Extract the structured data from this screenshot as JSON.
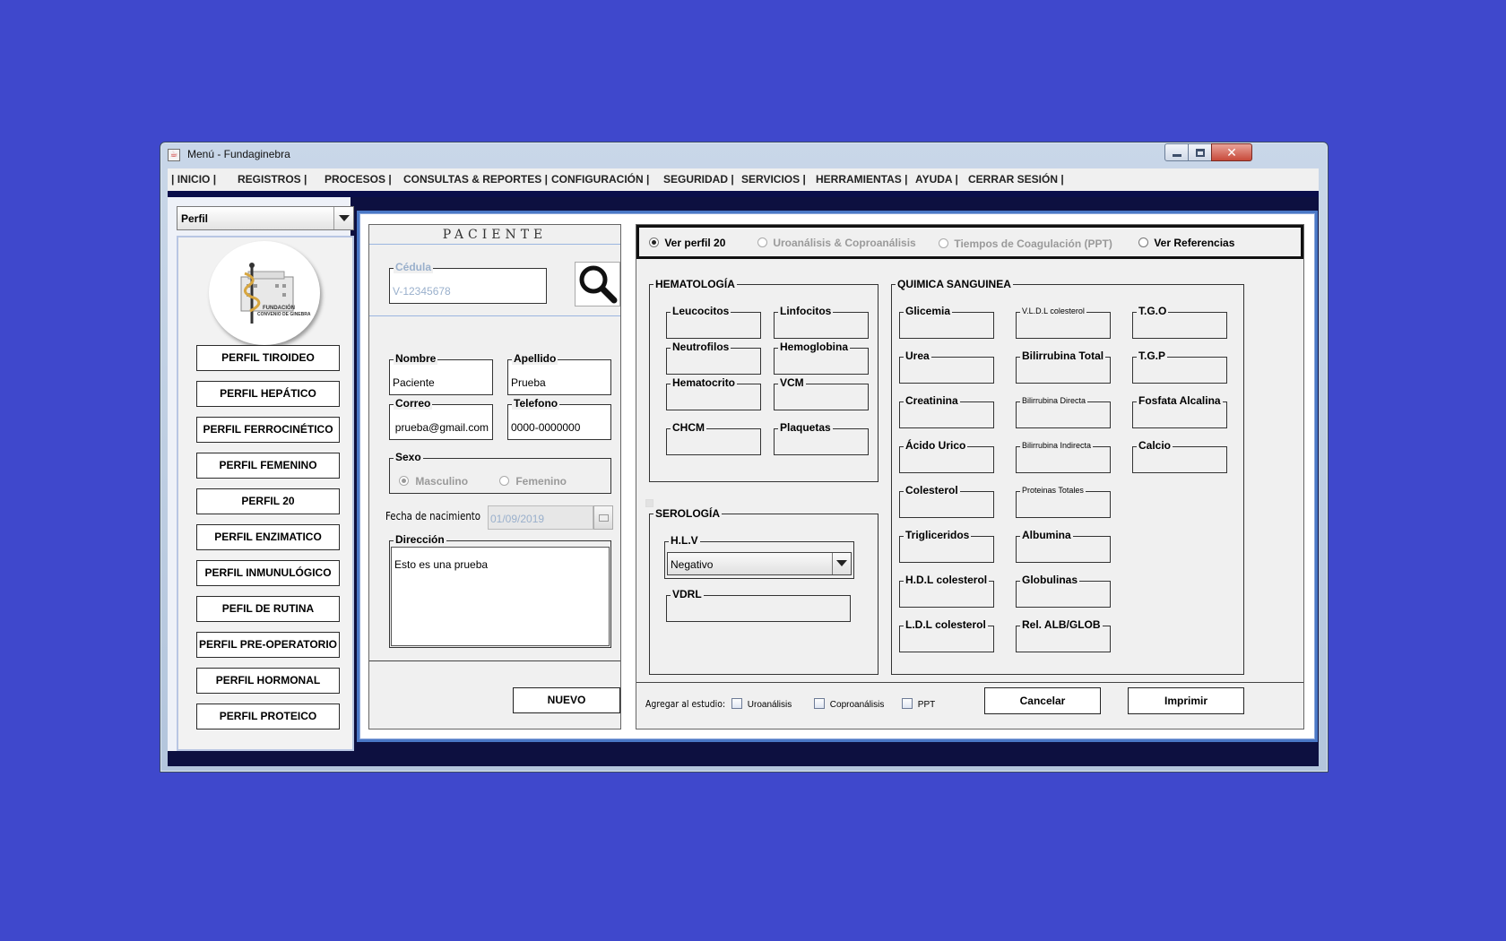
{
  "window": {
    "title": "Menú - Fundaginebra",
    "close_glyph": "✕"
  },
  "menu": [
    "| INICIO |",
    "REGISTROS |",
    "PROCESOS |",
    "CONSULTAS & REPORTES |",
    "CONFIGURACIÓN |",
    "SEGURIDAD |",
    "SERVICIOS |",
    "HERRAMIENTAS |",
    "AYUDA |",
    "CERRAR SESIÓN |"
  ],
  "sidebar": {
    "select_value": "Perfil",
    "logo_text": [
      "FUNDACIÓN",
      "CONVENIO DE GINEBRA"
    ],
    "profiles": [
      "PERFIL TIROIDEO",
      "PERFIL HEPÁTICO",
      "PERFIL FERROCINÉTICO",
      "PERFIL FEMENINO",
      "PERFIL 20",
      "PERFIL ENZIMATICO",
      "PERFIL INMUNULÓGICO",
      "PEFIL DE RUTINA",
      "PERFIL PRE-OPERATORIO",
      "PERFIL HORMONAL",
      "PERFIL PROTEICO"
    ]
  },
  "patient": {
    "title": "PACIENTE",
    "cedula_label": "Cédula",
    "cedula_value": "V-12345678",
    "nombre_label": "Nombre",
    "nombre_value": "Paciente",
    "apellido_label": "Apellido",
    "apellido_value": "Prueba",
    "correo_label": "Correo",
    "correo_value": "prueba@gmail.com",
    "telefono_label": "Telefono",
    "telefono_value": "0000-0000000",
    "sexo_label": "Sexo",
    "masculino": "Masculino",
    "femenino": "Femenino",
    "fecha_label": "Fecha de nacimiento",
    "fecha_value": "01/09/2019",
    "direccion_label": "Dirección",
    "direccion_value": "Esto es una prueba",
    "nuevo_button": "NUEVO"
  },
  "view_options": [
    "Ver perfil 20",
    "Uroanálisis & Coproanálisis",
    "Tiempos de Coagulación (PPT)",
    "Ver Referencias"
  ],
  "hematologia": {
    "title": "HEMATOLOGÍA",
    "fields": [
      "Leucocitos",
      "Linfocitos",
      "Neutrofilos",
      "Hemoglobina",
      "Hematocrito",
      "VCM",
      "CHCM",
      "Plaquetas"
    ]
  },
  "serologia": {
    "title": "SEROLOGÍA",
    "hlv_label": "H.L.V",
    "hlv_value": "Negativo",
    "vdrl_label": "VDRL"
  },
  "quimica": {
    "title": "QUIMICA SANGUINEA",
    "col1": [
      "Glicemia",
      "Urea",
      "Creatinina",
      "Ácido Urico",
      "Colesterol",
      "Trigliceridos",
      "H.D.L colesterol",
      "L.D.L colesterol"
    ],
    "col2": [
      "V.L.D.L colesterol",
      "Bilirrubina Total",
      "Bilirrubina Directa",
      "Bilirrubina Indirecta",
      "Proteinas Totales",
      "Albumina",
      "Globulinas",
      "Rel. ALB/GLOB"
    ],
    "col3": [
      "T.G.O",
      "T.G.P",
      "Fosfata Alcalina",
      "Calcio"
    ]
  },
  "footer": {
    "agregar_label": "Agregar al estudio:",
    "checks": [
      "Uroanálisis",
      "Coproanálisis",
      "PPT"
    ],
    "cancelar": "Cancelar",
    "imprimir": "Imprimir"
  }
}
